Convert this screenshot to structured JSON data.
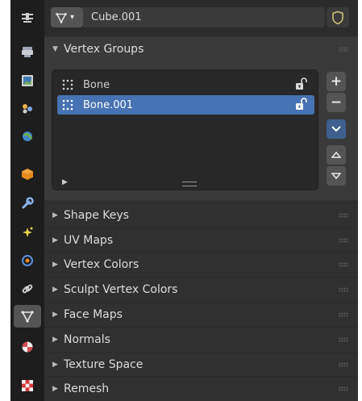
{
  "header": {
    "mesh_name": "Cube.001"
  },
  "sidebar_tabs": [
    {
      "name": "tool-icon"
    },
    {
      "name": "render-icon"
    },
    {
      "name": "output-icon"
    },
    {
      "name": "view-layer-icon"
    },
    {
      "name": "scene-icon"
    },
    {
      "name": "world-icon"
    },
    {
      "name": "object-icon"
    },
    {
      "name": "modifier-icon"
    },
    {
      "name": "particles-icon"
    },
    {
      "name": "physics-icon"
    },
    {
      "name": "constraints-icon"
    },
    {
      "name": "mesh-data-icon",
      "active": true
    },
    {
      "name": "material-icon"
    },
    {
      "name": "texture-icon"
    }
  ],
  "vertex_groups": {
    "title": "Vertex Groups",
    "items": [
      {
        "label": "Bone",
        "selected": false
      },
      {
        "label": "Bone.001",
        "selected": true
      }
    ]
  },
  "panels": [
    {
      "label": "Shape Keys"
    },
    {
      "label": "UV Maps"
    },
    {
      "label": "Vertex Colors"
    },
    {
      "label": "Sculpt Vertex Colors"
    },
    {
      "label": "Face Maps"
    },
    {
      "label": "Normals"
    },
    {
      "label": "Texture Space"
    },
    {
      "label": "Remesh"
    }
  ],
  "colors": {
    "selection": "#4772b3",
    "panel_bg": "#3a3a3a",
    "editor_bg": "#303030"
  }
}
